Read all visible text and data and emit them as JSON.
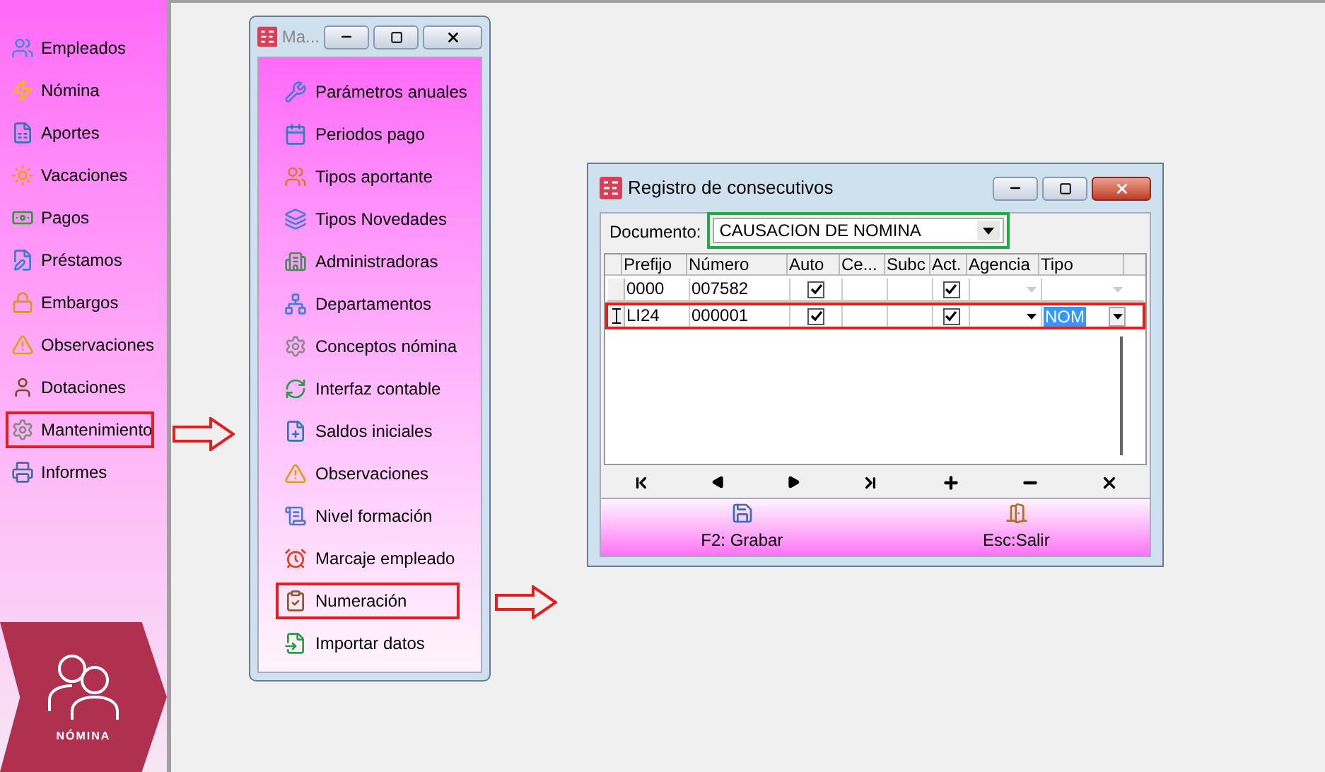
{
  "sidebar": {
    "items": [
      {
        "label": "Empleados",
        "highlighted": false
      },
      {
        "label": "Nómina",
        "highlighted": false
      },
      {
        "label": "Aportes",
        "highlighted": false
      },
      {
        "label": "Vacaciones",
        "highlighted": false
      },
      {
        "label": "Pagos",
        "highlighted": false
      },
      {
        "label": "Préstamos",
        "highlighted": false
      },
      {
        "label": "Embargos",
        "highlighted": false
      },
      {
        "label": "Observaciones",
        "highlighted": false
      },
      {
        "label": "Dotaciones",
        "highlighted": false
      },
      {
        "label": "Mantenimiento",
        "highlighted": true
      },
      {
        "label": "Informes",
        "highlighted": false
      }
    ],
    "logo_text": "NÓMINA"
  },
  "maintenance_window": {
    "title": "Ma...",
    "items": [
      {
        "label": "Parámetros anuales",
        "highlighted": false
      },
      {
        "label": "Periodos pago",
        "highlighted": false
      },
      {
        "label": "Tipos aportante",
        "highlighted": false
      },
      {
        "label": "Tipos Novedades",
        "highlighted": false
      },
      {
        "label": "Administradoras",
        "highlighted": false
      },
      {
        "label": "Departamentos",
        "highlighted": false
      },
      {
        "label": "Conceptos nómina",
        "highlighted": false
      },
      {
        "label": "Interfaz contable",
        "highlighted": false
      },
      {
        "label": "Saldos iniciales",
        "highlighted": false
      },
      {
        "label": "Observaciones",
        "highlighted": false
      },
      {
        "label": "Nivel formación",
        "highlighted": false
      },
      {
        "label": "Marcaje empleado",
        "highlighted": false
      },
      {
        "label": "Numeración",
        "highlighted": true
      },
      {
        "label": "Importar datos",
        "highlighted": false
      }
    ]
  },
  "registro_window": {
    "title": "Registro de consecutivos",
    "documento": {
      "label": "Documento:",
      "value": "CAUSACION DE NOMINA",
      "highlighted": true
    },
    "table": {
      "columns": [
        "Prefijo",
        "Número",
        "Auto",
        "Ce...",
        "Subc",
        "Act.",
        "Agencia",
        "Tipo"
      ],
      "rows": [
        {
          "current": false,
          "highlighted": false,
          "prefijo": "0000",
          "numero": "007582",
          "auto": true,
          "act": true
        },
        {
          "current": true,
          "highlighted": true,
          "prefijo": "LI24",
          "numero": "000001",
          "auto": true,
          "act": true,
          "tipo": "NOM"
        }
      ]
    },
    "buttons": [
      {
        "label": "F2: Grabar",
        "kind": "save"
      },
      {
        "label": "Esc:Salir",
        "kind": "exit"
      }
    ]
  }
}
